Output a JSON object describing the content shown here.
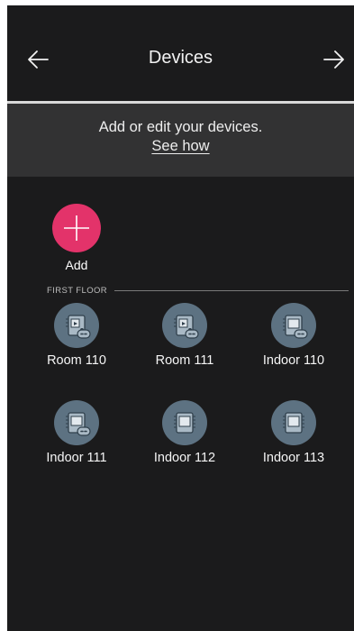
{
  "header": {
    "title": "Devices",
    "back_icon": "arrow-left-icon",
    "forward_icon": "arrow-right-icon"
  },
  "banner": {
    "text": "Add or edit your devices.",
    "link": "See how"
  },
  "add": {
    "label": "Add",
    "icon": "plus-icon",
    "color": "#e3336a"
  },
  "section": {
    "label": "FIRST FLOOR"
  },
  "devices": [
    {
      "label": "Room 110",
      "icon": "room-device-linked-icon"
    },
    {
      "label": "Room 111",
      "icon": "room-device-linked-icon"
    },
    {
      "label": "Indoor 110",
      "icon": "indoor-device-linked-icon"
    },
    {
      "label": "Indoor 111",
      "icon": "indoor-device-linked-icon"
    },
    {
      "label": "Indoor 112",
      "icon": "indoor-device-icon"
    },
    {
      "label": "Indoor 113",
      "icon": "indoor-device-icon"
    }
  ],
  "colors": {
    "background": "#1b1b1c",
    "banner": "#323233",
    "device_circle": "#5d7282"
  }
}
